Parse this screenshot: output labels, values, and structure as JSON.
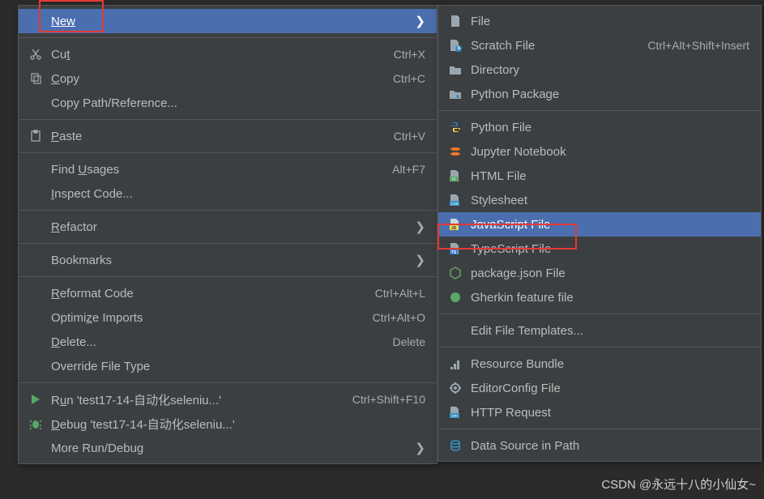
{
  "left": {
    "new": "New",
    "cut": "Cut",
    "cut_sc": "Ctrl+X",
    "copy": "Copy",
    "copy_sc": "Ctrl+C",
    "copy_path": "Copy Path/Reference...",
    "paste": "Paste",
    "paste_sc": "Ctrl+V",
    "find_usages": "Find Usages",
    "find_usages_sc": "Alt+F7",
    "inspect": "Inspect Code...",
    "refactor": "Refactor",
    "bookmarks": "Bookmarks",
    "reformat": "Reformat Code",
    "reformat_sc": "Ctrl+Alt+L",
    "optimize": "Optimize Imports",
    "optimize_sc": "Ctrl+Alt+O",
    "delete": "Delete...",
    "delete_sc": "Delete",
    "override": "Override File Type",
    "run": "Run 'test17-14-自动化seleniu...'",
    "run_sc": "Ctrl+Shift+F10",
    "debug": "Debug 'test17-14-自动化seleniu...'",
    "more_run": "More Run/Debug"
  },
  "right": {
    "file": "File",
    "scratch": "Scratch File",
    "scratch_sc": "Ctrl+Alt+Shift+Insert",
    "directory": "Directory",
    "python_pkg": "Python Package",
    "python_file": "Python File",
    "jupyter": "Jupyter Notebook",
    "html_file": "HTML File",
    "stylesheet": "Stylesheet",
    "js_file": "JavaScript File",
    "ts_file": "TypeScript File",
    "pkg_json": "package.json File",
    "gherkin": "Gherkin feature file",
    "edit_tpl": "Edit File Templates...",
    "resource": "Resource Bundle",
    "editorconfig": "EditorConfig File",
    "http_req": "HTTP Request",
    "data_source": "Data Source in Path"
  },
  "watermark": "CSDN @永远十八的小仙女~"
}
